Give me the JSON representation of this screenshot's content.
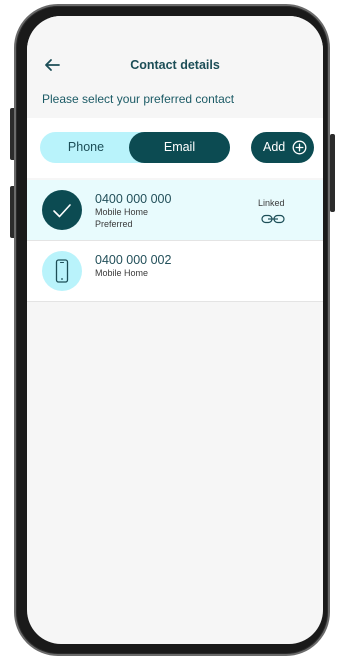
{
  "header": {
    "title": "Contact details",
    "back_icon": "arrow-left-icon",
    "subtitle": "Please select your preferred contact"
  },
  "toggle": {
    "options": [
      {
        "label": "Phone",
        "selected": false
      },
      {
        "label": "Email",
        "selected": true
      }
    ]
  },
  "add_button": {
    "label": "Add",
    "icon": "plus-circle-icon"
  },
  "contacts": [
    {
      "number": "0400 000 000",
      "type": "Mobile Home",
      "preferred_label": "Preferred",
      "status": "Linked",
      "status_icon": "link-icon",
      "avatar_icon": "checkmark-icon",
      "selected": true
    },
    {
      "number": "0400 000 002",
      "type": "Mobile Home",
      "avatar_icon": "mobile-phone-icon",
      "selected": false
    }
  ],
  "colors": {
    "primary": "#0c4b52",
    "accent_light": "#b9f3fb",
    "selected_row": "#e8fbfd",
    "heading_text": "#1c4e57"
  }
}
